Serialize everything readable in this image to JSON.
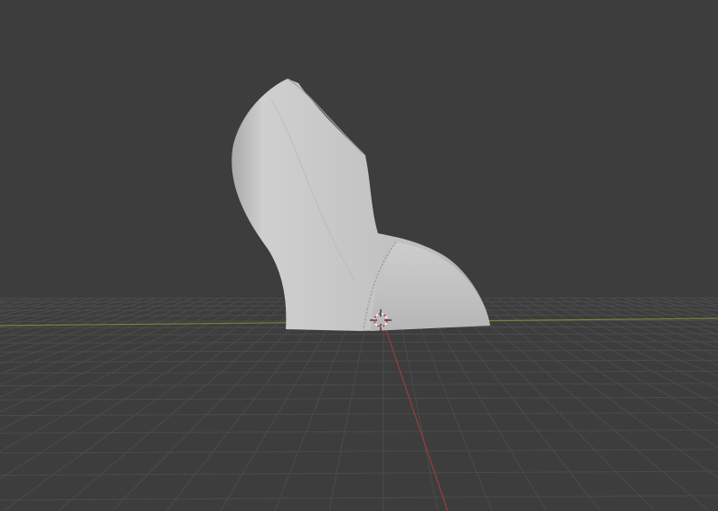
{
  "viewport": {
    "background_color": "#3d3d3d",
    "grid_color": "#4b4b4b",
    "x_axis_color": "#9a3b42",
    "y_axis_color": "#6d8a3a",
    "mesh_color": "#c8c8c8",
    "cursor_icon": "3d-cursor-icon"
  }
}
